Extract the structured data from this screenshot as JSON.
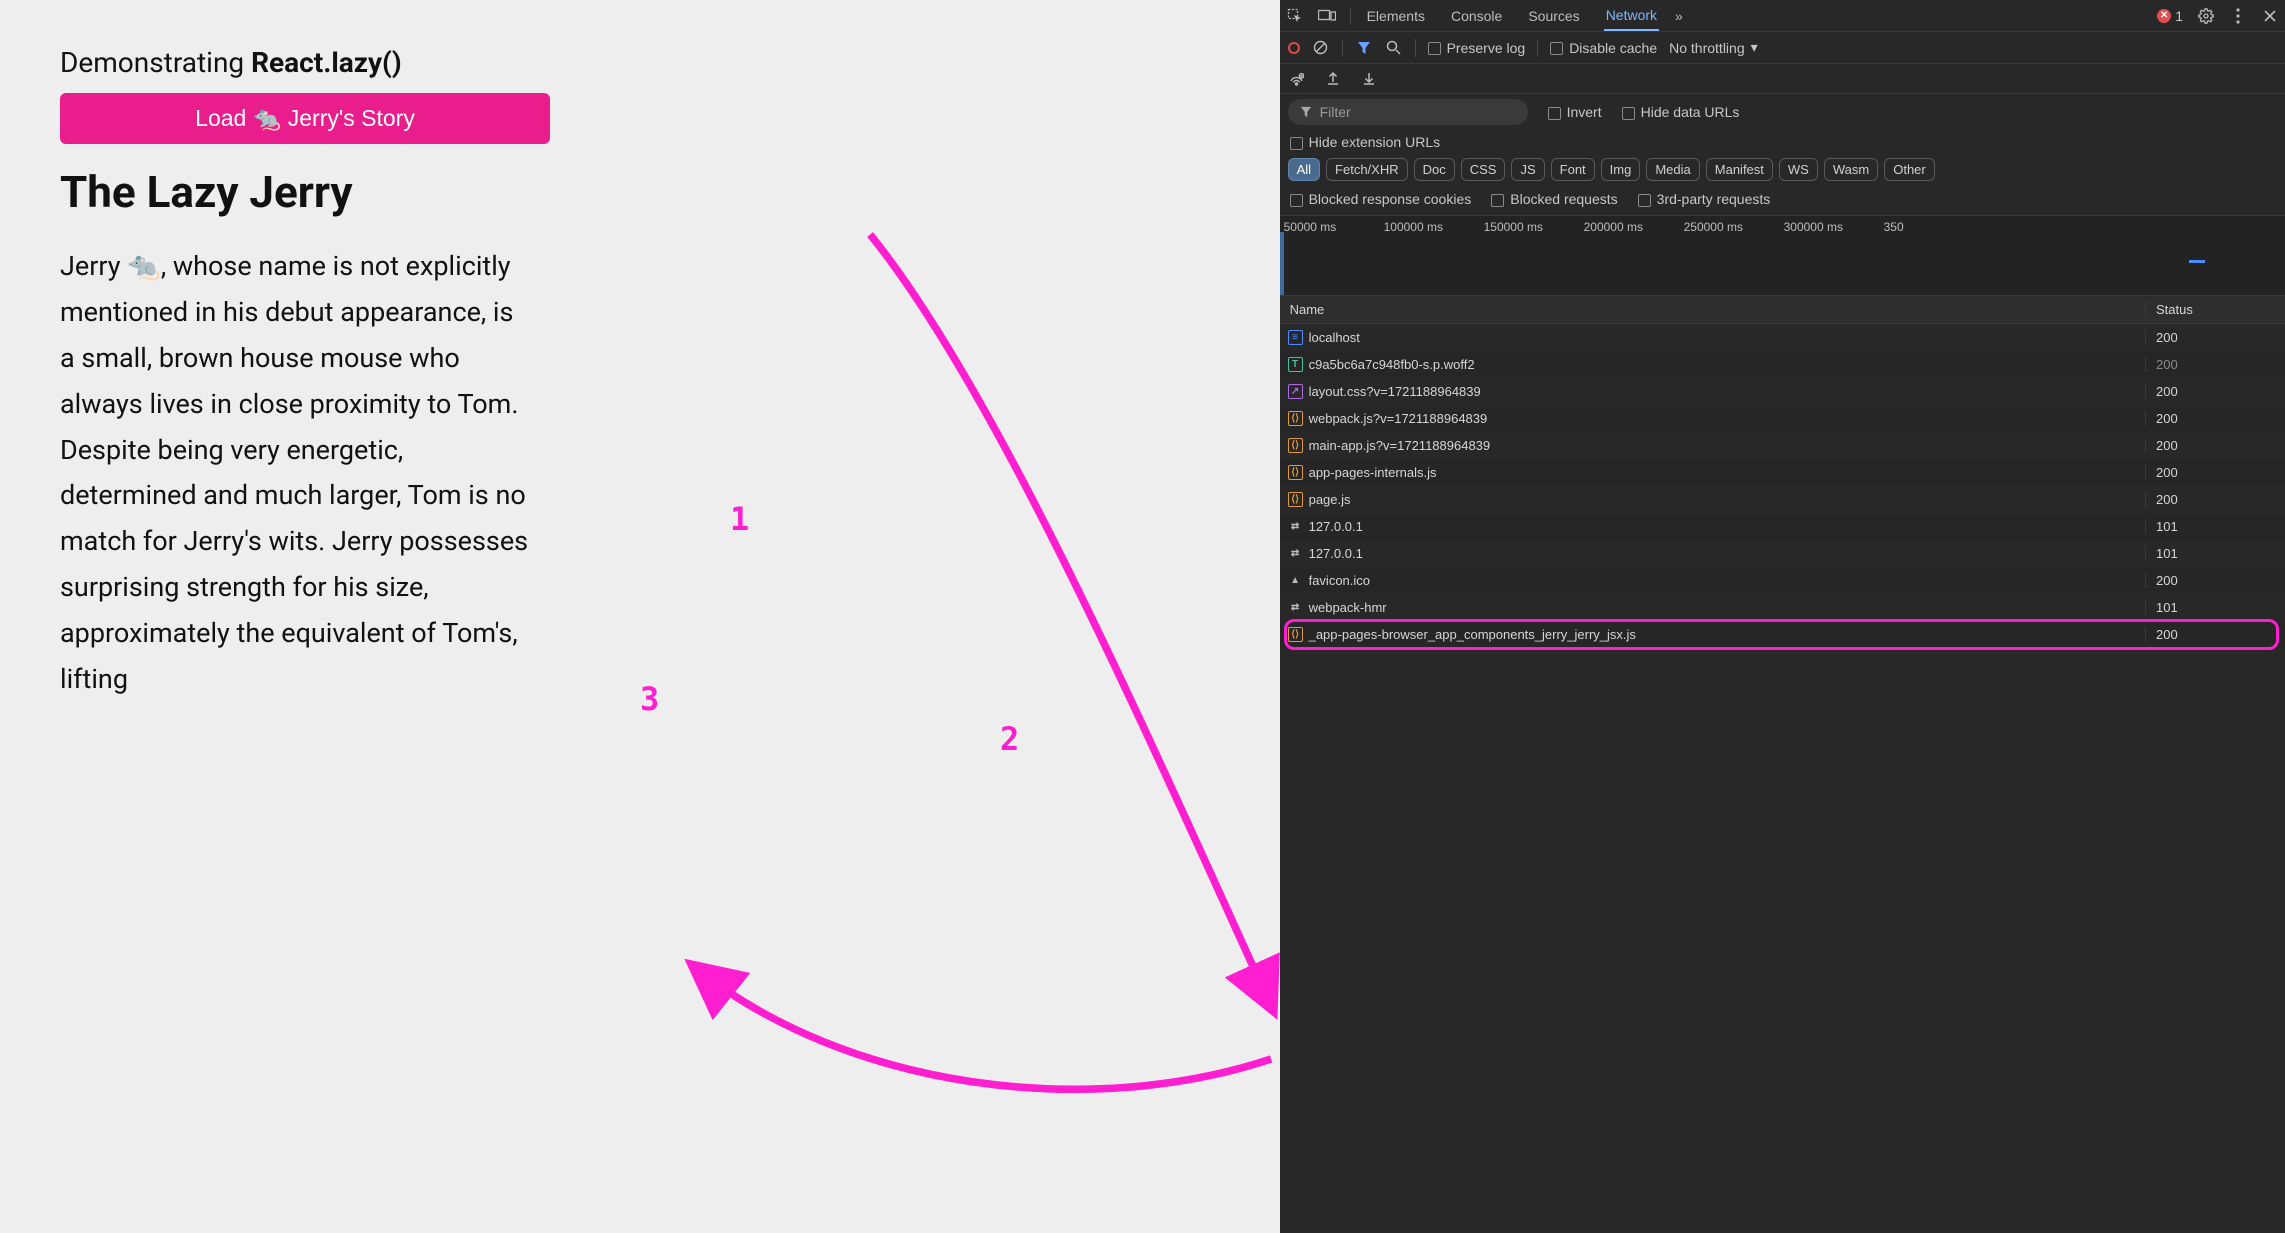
{
  "page": {
    "title_prefix": "Demonstrating ",
    "title_bold": "React.lazy()",
    "button_label": "Load 🐀 Jerry's Story",
    "story_title": "The Lazy Jerry",
    "story_body": "Jerry 🐀, whose name is not explicitly mentioned in his debut appearance, is a small, brown house mouse who always lives in close proximity to Tom. Despite being very energetic, determined and much larger, Tom is no match for Jerry's wits. Jerry possesses surprising strength for his size, approximately the equivalent of Tom's, lifting"
  },
  "annotations": {
    "n1": "1",
    "n2": "2",
    "n3": "3"
  },
  "devtools": {
    "tabs": [
      "Elements",
      "Console",
      "Sources",
      "Network"
    ],
    "active_tab": "Network",
    "overflow": "»",
    "error_count": "1",
    "toolbar": {
      "preserve_log": "Preserve log",
      "disable_cache": "Disable cache",
      "throttling": "No throttling"
    },
    "filter": {
      "placeholder": "Filter",
      "invert": "Invert",
      "hide_data_urls": "Hide data URLs",
      "hide_extension_urls": "Hide extension URLs"
    },
    "types": [
      "All",
      "Fetch/XHR",
      "Doc",
      "CSS",
      "JS",
      "Font",
      "Img",
      "Media",
      "Manifest",
      "WS",
      "Wasm",
      "Other"
    ],
    "active_type": "All",
    "blocked": {
      "response_cookies": "Blocked response cookies",
      "requests": "Blocked requests",
      "third_party": "3rd-party requests"
    },
    "timeline_ticks": [
      "50000 ms",
      "100000 ms",
      "150000 ms",
      "200000 ms",
      "250000 ms",
      "300000 ms",
      "350"
    ],
    "columns": {
      "name": "Name",
      "status": "Status"
    },
    "rows": [
      {
        "icon": "doc",
        "name": "localhost",
        "status": "200"
      },
      {
        "icon": "font",
        "name": "c9a5bc6a7c948fb0-s.p.woff2",
        "status": "200",
        "muted_status": true
      },
      {
        "icon": "css",
        "name": "layout.css?v=1721188964839",
        "status": "200"
      },
      {
        "icon": "js",
        "name": "webpack.js?v=1721188964839",
        "status": "200"
      },
      {
        "icon": "js",
        "name": "main-app.js?v=1721188964839",
        "status": "200"
      },
      {
        "icon": "js",
        "name": "app-pages-internals.js",
        "status": "200"
      },
      {
        "icon": "js",
        "name": "page.js",
        "status": "200"
      },
      {
        "icon": "ws",
        "name": "127.0.0.1",
        "status": "101"
      },
      {
        "icon": "ws",
        "name": "127.0.0.1",
        "status": "101"
      },
      {
        "icon": "img",
        "name": "favicon.ico",
        "status": "200"
      },
      {
        "icon": "ws",
        "name": "webpack-hmr",
        "status": "101"
      },
      {
        "icon": "js",
        "name": "_app-pages-browser_app_components_jerry_jerry_jsx.js",
        "status": "200",
        "highlight": true
      }
    ]
  }
}
